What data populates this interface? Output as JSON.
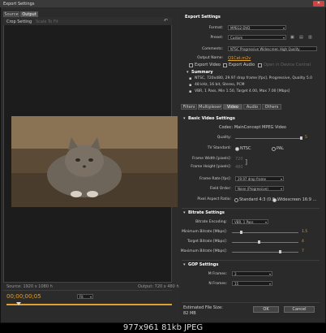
{
  "window": {
    "title": "Export Settings"
  },
  "left": {
    "tabs": [
      "Source",
      "Output"
    ],
    "crop_setting": "Crop Setting",
    "crop_value": "Scale To Fit",
    "source_info": "Source: 1920 x 1080 h",
    "output_info": "Output: 720 x 480 h",
    "timecode": "00;00;00;05",
    "fit_label": "Fit"
  },
  "export_settings": {
    "header": "Export Settings",
    "format_label": "Format:",
    "format_value": "MPEG2-DVD",
    "preset_label": "Preset:",
    "preset_value": "Custom",
    "comments_label": "Comments:",
    "comments_value": "NTSC Progressive Widescreen High Quality",
    "output_name_label": "Output Name:",
    "output_name_value": "Q1Cat.m2v",
    "export_video": "Export Video",
    "export_audio": "Export Audio",
    "open_device": "Open in Device Central",
    "summary_header": "Summary",
    "summary_lines": [
      "NTSC, 720x480, 29.97 drop frame [fps], Progressive, Quality 5.0",
      "48 kHz, 16 bit, Stereo, PCM",
      "VBR, 1 Pass, Min 1.50, Target 4.00, Max 7.00 [Mbps]"
    ]
  },
  "tabs2": [
    "Filters",
    "Multiplexer",
    "Video",
    "Audio",
    "Others"
  ],
  "video_settings": {
    "header": "Basic Video Settings",
    "codec": "Codec: MainConcept MPEG Video",
    "quality_label": "Quality:",
    "quality_value": "5",
    "tv_label": "TV Standard:",
    "tv_ntsc": "NTSC",
    "tv_pal": "PAL",
    "fw_label": "Frame Width [pixels]:",
    "fw_value": "720",
    "fh_label": "Frame Height [pixels]:",
    "fh_value": "480",
    "fr_label": "Frame Rate [fps]:",
    "fr_value": "29.97 drop frame",
    "fo_label": "Field Order:",
    "fo_value": "None (Progressive)",
    "par_label": "Pixel Aspect Ratio:",
    "par_a": "Standard 4:3 (0.9...",
    "par_b": "Widescreen 16:9 ..."
  },
  "bitrate": {
    "header": "Bitrate Settings",
    "enc_label": "Bitrate Encoding:",
    "enc_value": "VBR, 1 Pass",
    "min_label": "Minimum Bitrate [Mbps]:",
    "min_value": "1.5",
    "min_level": 0.12,
    "target_label": "Target Bitrate [Mbps]:",
    "target_value": "4",
    "target_level": 0.4,
    "max_label": "Maximum Bitrate [Mbps]:",
    "max_value": "7",
    "max_level": 0.72
  },
  "gop": {
    "header": "GOP Settings",
    "m_label": "M Frames:",
    "m_value": "3",
    "n_label": "N Frames:",
    "n_value": "15"
  },
  "footer": {
    "filesize_label": "Estimated File Size:",
    "filesize_value": "82 MB",
    "ok": "OK",
    "cancel": "Cancel"
  },
  "caption": "977x961 81kb JPEG"
}
